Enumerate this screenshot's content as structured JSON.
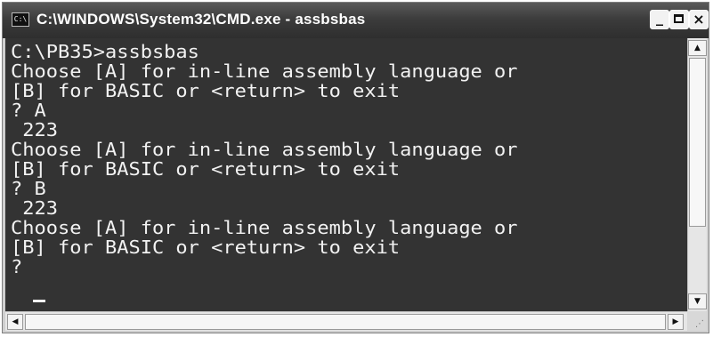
{
  "window": {
    "title": "C:\\WINDOWS\\System32\\CMD.exe - assbsbas",
    "icon": "cmd-icon",
    "icon_text": "C:\\"
  },
  "caption_buttons": {
    "minimize": "_",
    "close": "×"
  },
  "console": {
    "lines": [
      "C:\\PB35>assbsbas",
      "Choose [A] for in-line assembly language or",
      "[B] for BASIC or <return> to exit",
      "? A",
      " 223",
      "Choose [A] for in-line assembly language or",
      "[B] for BASIC or <return> to exit",
      "? B",
      " 223",
      "Choose [A] for in-line assembly language or",
      "[B] for BASIC or <return> to exit",
      "? "
    ],
    "background": "#333333",
    "foreground": "#f2f2f2"
  },
  "scrollbar": {
    "up_arrow": "▲",
    "down_arrow": "▼",
    "left_arrow": "◀",
    "right_arrow": "▶",
    "grip": "⋰"
  }
}
